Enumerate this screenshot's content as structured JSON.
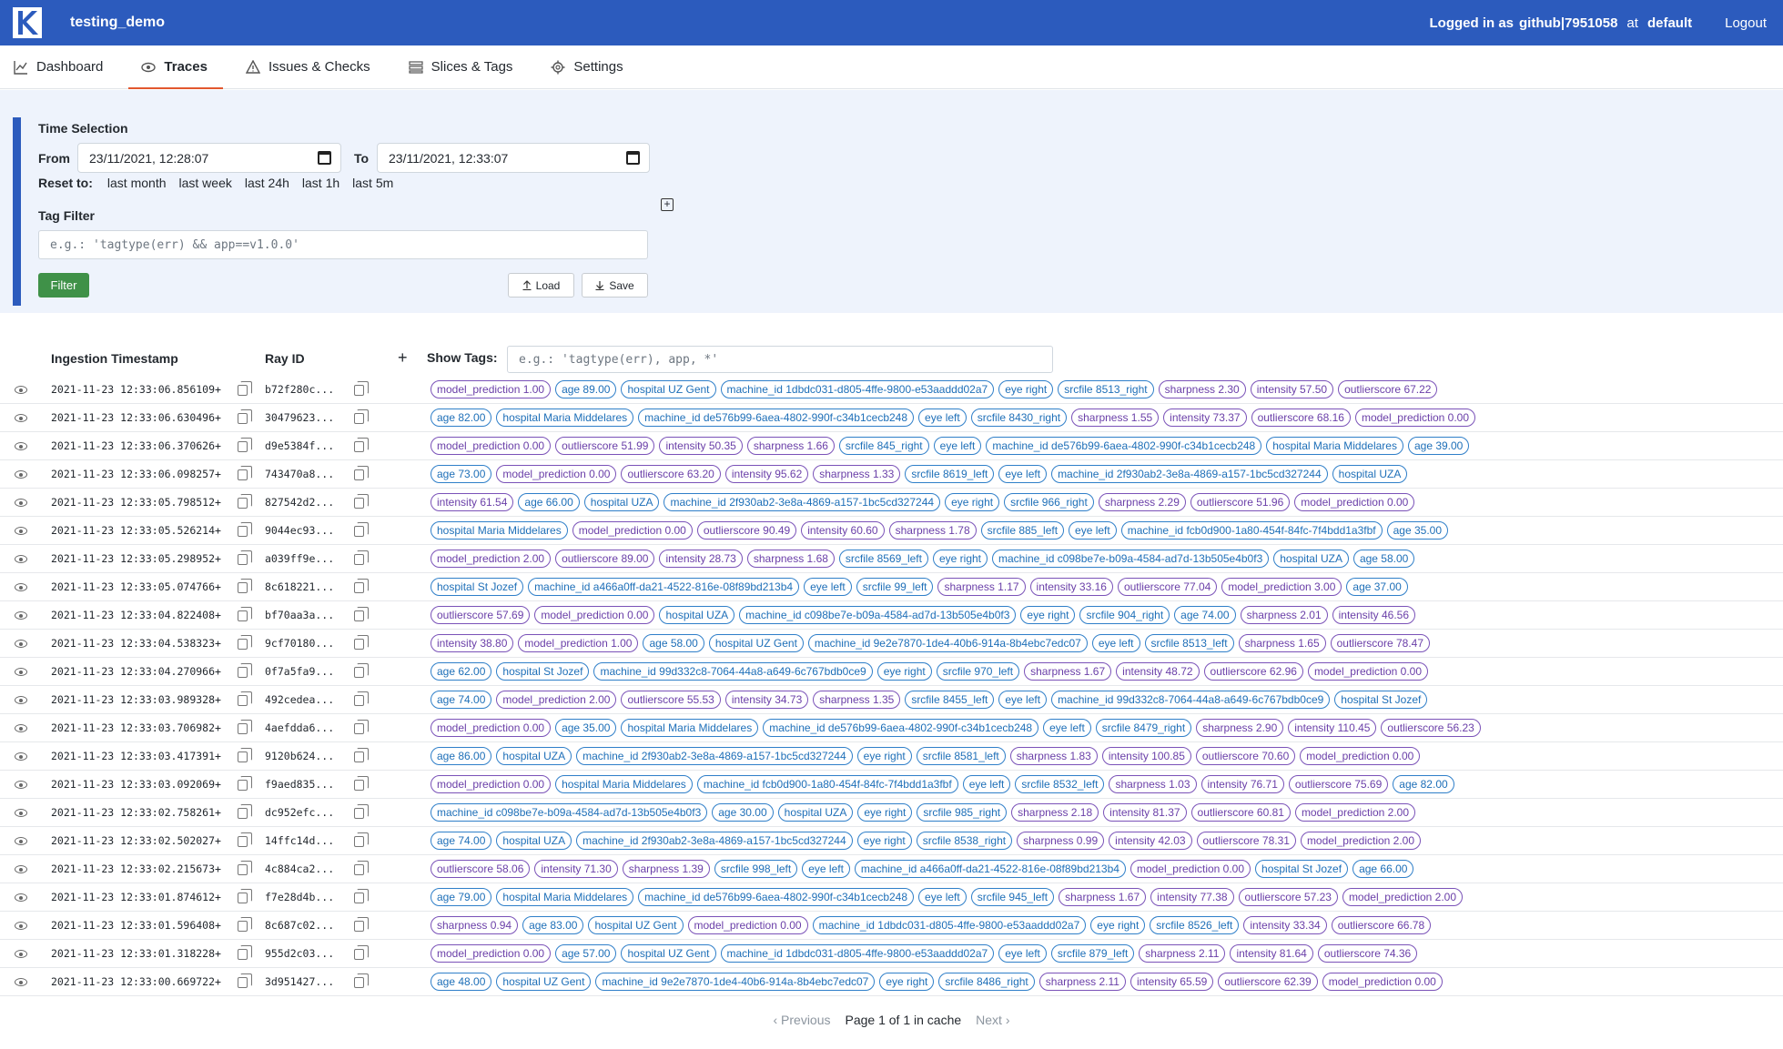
{
  "header": {
    "project": "testing_demo",
    "logged_in_label": "Logged in as",
    "user": "github|7951058",
    "at_label": "at",
    "org": "default",
    "logout": "Logout"
  },
  "nav": [
    {
      "label": "Dashboard",
      "icon": "chart-icon"
    },
    {
      "label": "Traces",
      "icon": "eye-icon",
      "active": true
    },
    {
      "label": "Issues & Checks",
      "icon": "warning-icon"
    },
    {
      "label": "Slices & Tags",
      "icon": "stack-icon"
    },
    {
      "label": "Settings",
      "icon": "gear-icon"
    }
  ],
  "filter": {
    "time_title": "Time Selection",
    "from_label": "From",
    "from_value": "23/11/2021, 12:28:07",
    "to_label": "To",
    "to_value": "23/11/2021, 12:33:07",
    "reset_label": "Reset to:",
    "reset_options": [
      "last month",
      "last week",
      "last 24h",
      "last 1h",
      "last 5m"
    ],
    "tag_title": "Tag Filter",
    "tag_placeholder": "e.g.: 'tagtype(err) && app==v1.0.0'",
    "filter_btn": "Filter",
    "load_btn": "Load",
    "save_btn": "Save"
  },
  "table": {
    "col_ts": "Ingestion Timestamp",
    "col_ray": "Ray ID",
    "show_tags_label": "Show Tags:",
    "show_tags_placeholder": "e.g.: 'tagtype(err), app, *'",
    "rows": [
      {
        "ts": "2021-11-23 12:33:06.856109+",
        "ray": "b72f280c...",
        "tags": [
          [
            "model_prediction 1.00",
            "p"
          ],
          [
            "age 89.00",
            "b"
          ],
          [
            "hospital UZ Gent",
            "b"
          ],
          [
            "machine_id 1dbdc031-d805-4ffe-9800-e53aaddd02a7",
            "b"
          ],
          [
            "eye right",
            "b"
          ],
          [
            "srcfile 8513_right",
            "b"
          ],
          [
            "sharpness 2.30",
            "p"
          ],
          [
            "intensity 57.50",
            "p"
          ],
          [
            "outlierscore 67.22",
            "p"
          ]
        ]
      },
      {
        "ts": "2021-11-23 12:33:06.630496+",
        "ray": "30479623...",
        "tags": [
          [
            "age 82.00",
            "b"
          ],
          [
            "hospital Maria Middelares",
            "b"
          ],
          [
            "machine_id de576b99-6aea-4802-990f-c34b1cecb248",
            "b"
          ],
          [
            "eye left",
            "b"
          ],
          [
            "srcfile 8430_right",
            "b"
          ],
          [
            "sharpness 1.55",
            "p"
          ],
          [
            "intensity 73.37",
            "p"
          ],
          [
            "outlierscore 68.16",
            "p"
          ],
          [
            "model_prediction 0.00",
            "p"
          ]
        ]
      },
      {
        "ts": "2021-11-23 12:33:06.370626+",
        "ray": "d9e5384f...",
        "tags": [
          [
            "model_prediction 0.00",
            "p"
          ],
          [
            "outlierscore 51.99",
            "p"
          ],
          [
            "intensity 50.35",
            "p"
          ],
          [
            "sharpness 1.66",
            "p"
          ],
          [
            "srcfile 845_right",
            "b"
          ],
          [
            "eye left",
            "b"
          ],
          [
            "machine_id de576b99-6aea-4802-990f-c34b1cecb248",
            "b"
          ],
          [
            "hospital Maria Middelares",
            "b"
          ],
          [
            "age 39.00",
            "b"
          ]
        ]
      },
      {
        "ts": "2021-11-23 12:33:06.098257+",
        "ray": "743470a8...",
        "tags": [
          [
            "age 73.00",
            "b"
          ],
          [
            "model_prediction 0.00",
            "p"
          ],
          [
            "outlierscore 63.20",
            "p"
          ],
          [
            "intensity 95.62",
            "p"
          ],
          [
            "sharpness 1.33",
            "p"
          ],
          [
            "srcfile 8619_left",
            "b"
          ],
          [
            "eye left",
            "b"
          ],
          [
            "machine_id 2f930ab2-3e8a-4869-a157-1bc5cd327244",
            "b"
          ],
          [
            "hospital UZA",
            "b"
          ]
        ]
      },
      {
        "ts": "2021-11-23 12:33:05.798512+",
        "ray": "827542d2...",
        "tags": [
          [
            "intensity 61.54",
            "p"
          ],
          [
            "age 66.00",
            "b"
          ],
          [
            "hospital UZA",
            "b"
          ],
          [
            "machine_id 2f930ab2-3e8a-4869-a157-1bc5cd327244",
            "b"
          ],
          [
            "eye right",
            "b"
          ],
          [
            "srcfile 966_right",
            "b"
          ],
          [
            "sharpness 2.29",
            "p"
          ],
          [
            "outlierscore 51.96",
            "p"
          ],
          [
            "model_prediction 0.00",
            "p"
          ]
        ]
      },
      {
        "ts": "2021-11-23 12:33:05.526214+",
        "ray": "9044ec93...",
        "tags": [
          [
            "hospital Maria Middelares",
            "b"
          ],
          [
            "model_prediction 0.00",
            "p"
          ],
          [
            "outlierscore 90.49",
            "p"
          ],
          [
            "intensity 60.60",
            "p"
          ],
          [
            "sharpness 1.78",
            "p"
          ],
          [
            "srcfile 885_left",
            "b"
          ],
          [
            "eye left",
            "b"
          ],
          [
            "machine_id fcb0d900-1a80-454f-84fc-7f4bdd1a3fbf",
            "b"
          ],
          [
            "age 35.00",
            "b"
          ]
        ]
      },
      {
        "ts": "2021-11-23 12:33:05.298952+",
        "ray": "a039ff9e...",
        "tags": [
          [
            "model_prediction 2.00",
            "p"
          ],
          [
            "outlierscore 89.00",
            "p"
          ],
          [
            "intensity 28.73",
            "p"
          ],
          [
            "sharpness 1.68",
            "p"
          ],
          [
            "srcfile 8569_left",
            "b"
          ],
          [
            "eye right",
            "b"
          ],
          [
            "machine_id c098be7e-b09a-4584-ad7d-13b505e4b0f3",
            "b"
          ],
          [
            "hospital UZA",
            "b"
          ],
          [
            "age 58.00",
            "b"
          ]
        ]
      },
      {
        "ts": "2021-11-23 12:33:05.074766+",
        "ray": "8c618221...",
        "tags": [
          [
            "hospital St Jozef",
            "b"
          ],
          [
            "machine_id a466a0ff-da21-4522-816e-08f89bd213b4",
            "b"
          ],
          [
            "eye left",
            "b"
          ],
          [
            "srcfile 99_left",
            "b"
          ],
          [
            "sharpness 1.17",
            "p"
          ],
          [
            "intensity 33.16",
            "p"
          ],
          [
            "outlierscore 77.04",
            "p"
          ],
          [
            "model_prediction 3.00",
            "p"
          ],
          [
            "age 37.00",
            "b"
          ]
        ]
      },
      {
        "ts": "2021-11-23 12:33:04.822408+",
        "ray": "bf70aa3a...",
        "tags": [
          [
            "outlierscore 57.69",
            "p"
          ],
          [
            "model_prediction 0.00",
            "p"
          ],
          [
            "hospital UZA",
            "b"
          ],
          [
            "machine_id c098be7e-b09a-4584-ad7d-13b505e4b0f3",
            "b"
          ],
          [
            "eye right",
            "b"
          ],
          [
            "srcfile 904_right",
            "b"
          ],
          [
            "age 74.00",
            "b"
          ],
          [
            "sharpness 2.01",
            "p"
          ],
          [
            "intensity 46.56",
            "p"
          ]
        ]
      },
      {
        "ts": "2021-11-23 12:33:04.538323+",
        "ray": "9cf70180...",
        "tags": [
          [
            "intensity 38.80",
            "p"
          ],
          [
            "model_prediction 1.00",
            "p"
          ],
          [
            "age 58.00",
            "b"
          ],
          [
            "hospital UZ Gent",
            "b"
          ],
          [
            "machine_id 9e2e7870-1de4-40b6-914a-8b4ebc7edc07",
            "b"
          ],
          [
            "eye left",
            "b"
          ],
          [
            "srcfile 8513_left",
            "b"
          ],
          [
            "sharpness 1.65",
            "p"
          ],
          [
            "outlierscore 78.47",
            "p"
          ]
        ]
      },
      {
        "ts": "2021-11-23 12:33:04.270966+",
        "ray": "0f7a5fa9...",
        "tags": [
          [
            "age 62.00",
            "b"
          ],
          [
            "hospital St Jozef",
            "b"
          ],
          [
            "machine_id 99d332c8-7064-44a8-a649-6c767bdb0ce9",
            "b"
          ],
          [
            "eye right",
            "b"
          ],
          [
            "srcfile 970_left",
            "b"
          ],
          [
            "sharpness 1.67",
            "p"
          ],
          [
            "intensity 48.72",
            "p"
          ],
          [
            "outlierscore 62.96",
            "p"
          ],
          [
            "model_prediction 0.00",
            "p"
          ]
        ]
      },
      {
        "ts": "2021-11-23 12:33:03.989328+",
        "ray": "492cedea...",
        "tags": [
          [
            "age 74.00",
            "b"
          ],
          [
            "model_prediction 2.00",
            "p"
          ],
          [
            "outlierscore 55.53",
            "p"
          ],
          [
            "intensity 34.73",
            "p"
          ],
          [
            "sharpness 1.35",
            "p"
          ],
          [
            "srcfile 8455_left",
            "b"
          ],
          [
            "eye left",
            "b"
          ],
          [
            "machine_id 99d332c8-7064-44a8-a649-6c767bdb0ce9",
            "b"
          ],
          [
            "hospital St Jozef",
            "b"
          ]
        ]
      },
      {
        "ts": "2021-11-23 12:33:03.706982+",
        "ray": "4aefdda6...",
        "tags": [
          [
            "model_prediction 0.00",
            "p"
          ],
          [
            "age 35.00",
            "b"
          ],
          [
            "hospital Maria Middelares",
            "b"
          ],
          [
            "machine_id de576b99-6aea-4802-990f-c34b1cecb248",
            "b"
          ],
          [
            "eye left",
            "b"
          ],
          [
            "srcfile 8479_right",
            "b"
          ],
          [
            "sharpness 2.90",
            "p"
          ],
          [
            "intensity 110.45",
            "p"
          ],
          [
            "outlierscore 56.23",
            "p"
          ]
        ]
      },
      {
        "ts": "2021-11-23 12:33:03.417391+",
        "ray": "9120b624...",
        "tags": [
          [
            "age 86.00",
            "b"
          ],
          [
            "hospital UZA",
            "b"
          ],
          [
            "machine_id 2f930ab2-3e8a-4869-a157-1bc5cd327244",
            "b"
          ],
          [
            "eye right",
            "b"
          ],
          [
            "srcfile 8581_left",
            "b"
          ],
          [
            "sharpness 1.83",
            "p"
          ],
          [
            "intensity 100.85",
            "p"
          ],
          [
            "outlierscore 70.60",
            "p"
          ],
          [
            "model_prediction 0.00",
            "p"
          ]
        ]
      },
      {
        "ts": "2021-11-23 12:33:03.092069+",
        "ray": "f9aed835...",
        "tags": [
          [
            "model_prediction 0.00",
            "p"
          ],
          [
            "hospital Maria Middelares",
            "b"
          ],
          [
            "machine_id fcb0d900-1a80-454f-84fc-7f4bdd1a3fbf",
            "b"
          ],
          [
            "eye left",
            "b"
          ],
          [
            "srcfile 8532_left",
            "b"
          ],
          [
            "sharpness 1.03",
            "p"
          ],
          [
            "intensity 76.71",
            "p"
          ],
          [
            "outlierscore 75.69",
            "p"
          ],
          [
            "age 82.00",
            "b"
          ]
        ]
      },
      {
        "ts": "2021-11-23 12:33:02.758261+",
        "ray": "dc952efc...",
        "tags": [
          [
            "machine_id c098be7e-b09a-4584-ad7d-13b505e4b0f3",
            "b"
          ],
          [
            "age 30.00",
            "b"
          ],
          [
            "hospital UZA",
            "b"
          ],
          [
            "eye right",
            "b"
          ],
          [
            "srcfile 985_right",
            "b"
          ],
          [
            "sharpness 2.18",
            "p"
          ],
          [
            "intensity 81.37",
            "p"
          ],
          [
            "outlierscore 60.81",
            "p"
          ],
          [
            "model_prediction 2.00",
            "p"
          ]
        ]
      },
      {
        "ts": "2021-11-23 12:33:02.502027+",
        "ray": "14ffc14d...",
        "tags": [
          [
            "age 74.00",
            "b"
          ],
          [
            "hospital UZA",
            "b"
          ],
          [
            "machine_id 2f930ab2-3e8a-4869-a157-1bc5cd327244",
            "b"
          ],
          [
            "eye right",
            "b"
          ],
          [
            "srcfile 8538_right",
            "b"
          ],
          [
            "sharpness 0.99",
            "p"
          ],
          [
            "intensity 42.03",
            "p"
          ],
          [
            "outlierscore 78.31",
            "p"
          ],
          [
            "model_prediction 2.00",
            "p"
          ]
        ]
      },
      {
        "ts": "2021-11-23 12:33:02.215673+",
        "ray": "4c884ca2...",
        "tags": [
          [
            "outlierscore 58.06",
            "p"
          ],
          [
            "intensity 71.30",
            "p"
          ],
          [
            "sharpness 1.39",
            "p"
          ],
          [
            "srcfile 998_left",
            "b"
          ],
          [
            "eye left",
            "b"
          ],
          [
            "machine_id a466a0ff-da21-4522-816e-08f89bd213b4",
            "b"
          ],
          [
            "model_prediction 0.00",
            "p"
          ],
          [
            "hospital St Jozef",
            "b"
          ],
          [
            "age 66.00",
            "b"
          ]
        ]
      },
      {
        "ts": "2021-11-23 12:33:01.874612+",
        "ray": "f7e28d4b...",
        "tags": [
          [
            "age 79.00",
            "b"
          ],
          [
            "hospital Maria Middelares",
            "b"
          ],
          [
            "machine_id de576b99-6aea-4802-990f-c34b1cecb248",
            "b"
          ],
          [
            "eye left",
            "b"
          ],
          [
            "srcfile 945_left",
            "b"
          ],
          [
            "sharpness 1.67",
            "p"
          ],
          [
            "intensity 77.38",
            "p"
          ],
          [
            "outlierscore 57.23",
            "p"
          ],
          [
            "model_prediction 2.00",
            "p"
          ]
        ]
      },
      {
        "ts": "2021-11-23 12:33:01.596408+",
        "ray": "8c687c02...",
        "tags": [
          [
            "sharpness 0.94",
            "p"
          ],
          [
            "age 83.00",
            "b"
          ],
          [
            "hospital UZ Gent",
            "b"
          ],
          [
            "model_prediction 0.00",
            "p"
          ],
          [
            "machine_id 1dbdc031-d805-4ffe-9800-e53aaddd02a7",
            "b"
          ],
          [
            "eye right",
            "b"
          ],
          [
            "srcfile 8526_left",
            "b"
          ],
          [
            "intensity 33.34",
            "p"
          ],
          [
            "outlierscore 66.78",
            "p"
          ]
        ]
      },
      {
        "ts": "2021-11-23 12:33:01.318228+",
        "ray": "955d2c03...",
        "tags": [
          [
            "model_prediction 0.00",
            "p"
          ],
          [
            "age 57.00",
            "b"
          ],
          [
            "hospital UZ Gent",
            "b"
          ],
          [
            "machine_id 1dbdc031-d805-4ffe-9800-e53aaddd02a7",
            "b"
          ],
          [
            "eye left",
            "b"
          ],
          [
            "srcfile 879_left",
            "b"
          ],
          [
            "sharpness 2.11",
            "p"
          ],
          [
            "intensity 81.64",
            "p"
          ],
          [
            "outlierscore 74.36",
            "p"
          ]
        ]
      },
      {
        "ts": "2021-11-23 12:33:00.669722+",
        "ray": "3d951427...",
        "tags": [
          [
            "age 48.00",
            "b"
          ],
          [
            "hospital UZ Gent",
            "b"
          ],
          [
            "machine_id 9e2e7870-1de4-40b6-914a-8b4ebc7edc07",
            "b"
          ],
          [
            "eye right",
            "b"
          ],
          [
            "srcfile 8486_right",
            "b"
          ],
          [
            "sharpness 2.11",
            "p"
          ],
          [
            "intensity 65.59",
            "p"
          ],
          [
            "outlierscore 62.39",
            "p"
          ],
          [
            "model_prediction 0.00",
            "p"
          ]
        ]
      }
    ]
  },
  "pager": {
    "prev": "Previous",
    "info": "Page 1 of 1 in cache",
    "next": "Next"
  }
}
